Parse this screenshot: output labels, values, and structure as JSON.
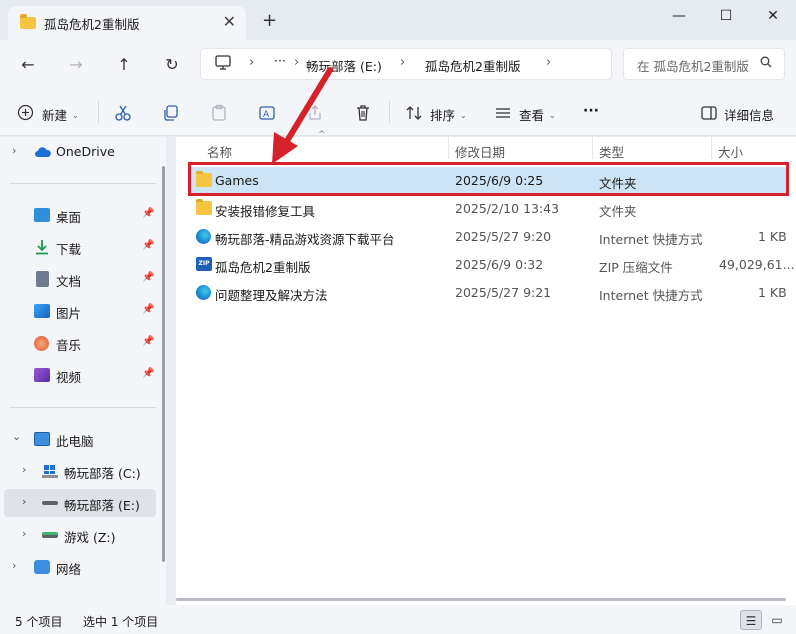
{
  "window": {
    "tab_title": "孤岛危机2重制版",
    "tab_close_glyph": "✕",
    "new_tab_glyph": "+",
    "minimize_glyph": "—",
    "maximize_glyph": "☐",
    "close_glyph": "✕"
  },
  "nav": {
    "back_glyph": "←",
    "forward_glyph": "→",
    "up_glyph": "↑",
    "refresh_glyph": "↻"
  },
  "address": {
    "more_glyph": "···",
    "sep_glyph": "›",
    "crumbs": [
      "畅玩部落 (E:)",
      "孤岛危机2重制版"
    ],
    "search_placeholder": "在 孤岛危机2重制版 中搜索"
  },
  "toolbar": {
    "new_label": "新建",
    "sort_label": "排序",
    "view_label": "查看",
    "more_glyph": "···",
    "details_label": "详细信息",
    "caret_glyph": "⌄"
  },
  "sidebar": {
    "chev_right": "›",
    "chev_down": "⌄",
    "pin_glyph": "📌",
    "onedrive": "OneDrive",
    "quick": [
      {
        "label": "桌面"
      },
      {
        "label": "下载"
      },
      {
        "label": "文档"
      },
      {
        "label": "图片"
      },
      {
        "label": "音乐"
      },
      {
        "label": "视频"
      }
    ],
    "this_pc": "此电脑",
    "drives": [
      {
        "label": "畅玩部落 (C:)"
      },
      {
        "label": "畅玩部落 (E:)"
      },
      {
        "label": "游戏 (Z:)"
      }
    ],
    "network": "网络"
  },
  "columns": {
    "name": "名称",
    "modified": "修改日期",
    "type": "类型",
    "size": "大小",
    "sort_glyph": "^"
  },
  "files": [
    {
      "name": "Games",
      "modified": "2025/6/9 0:25",
      "type": "文件夹",
      "size": "",
      "icon": "folder-icon"
    },
    {
      "name": "安装报错修复工具",
      "modified": "2025/2/10 13:43",
      "type": "文件夹",
      "size": "",
      "icon": "folder-icon"
    },
    {
      "name": "畅玩部落-精品游戏资源下载平台",
      "modified": "2025/5/27 9:20",
      "type": "Internet 快捷方式",
      "size": "1 KB",
      "icon": "edge-icon"
    },
    {
      "name": "孤岛危机2重制版",
      "modified": "2025/6/9 0:32",
      "type": "ZIP 压缩文件",
      "size": "49,029,61...",
      "icon": "zip-icon"
    },
    {
      "name": "问题整理及解决方法",
      "modified": "2025/5/27 9:21",
      "type": "Internet 快捷方式",
      "size": "1 KB",
      "icon": "edge-icon"
    }
  ],
  "zip_badge": "ZIP",
  "status": {
    "item_count": "5 个项目",
    "selected": "选中 1 个项目",
    "details_view_glyph": "☰",
    "tiles_view_glyph": "▭"
  },
  "colors": {
    "highlight_border": "#d6202a",
    "arrow": "#d6202a",
    "selected_row": "#cde4f7"
  }
}
